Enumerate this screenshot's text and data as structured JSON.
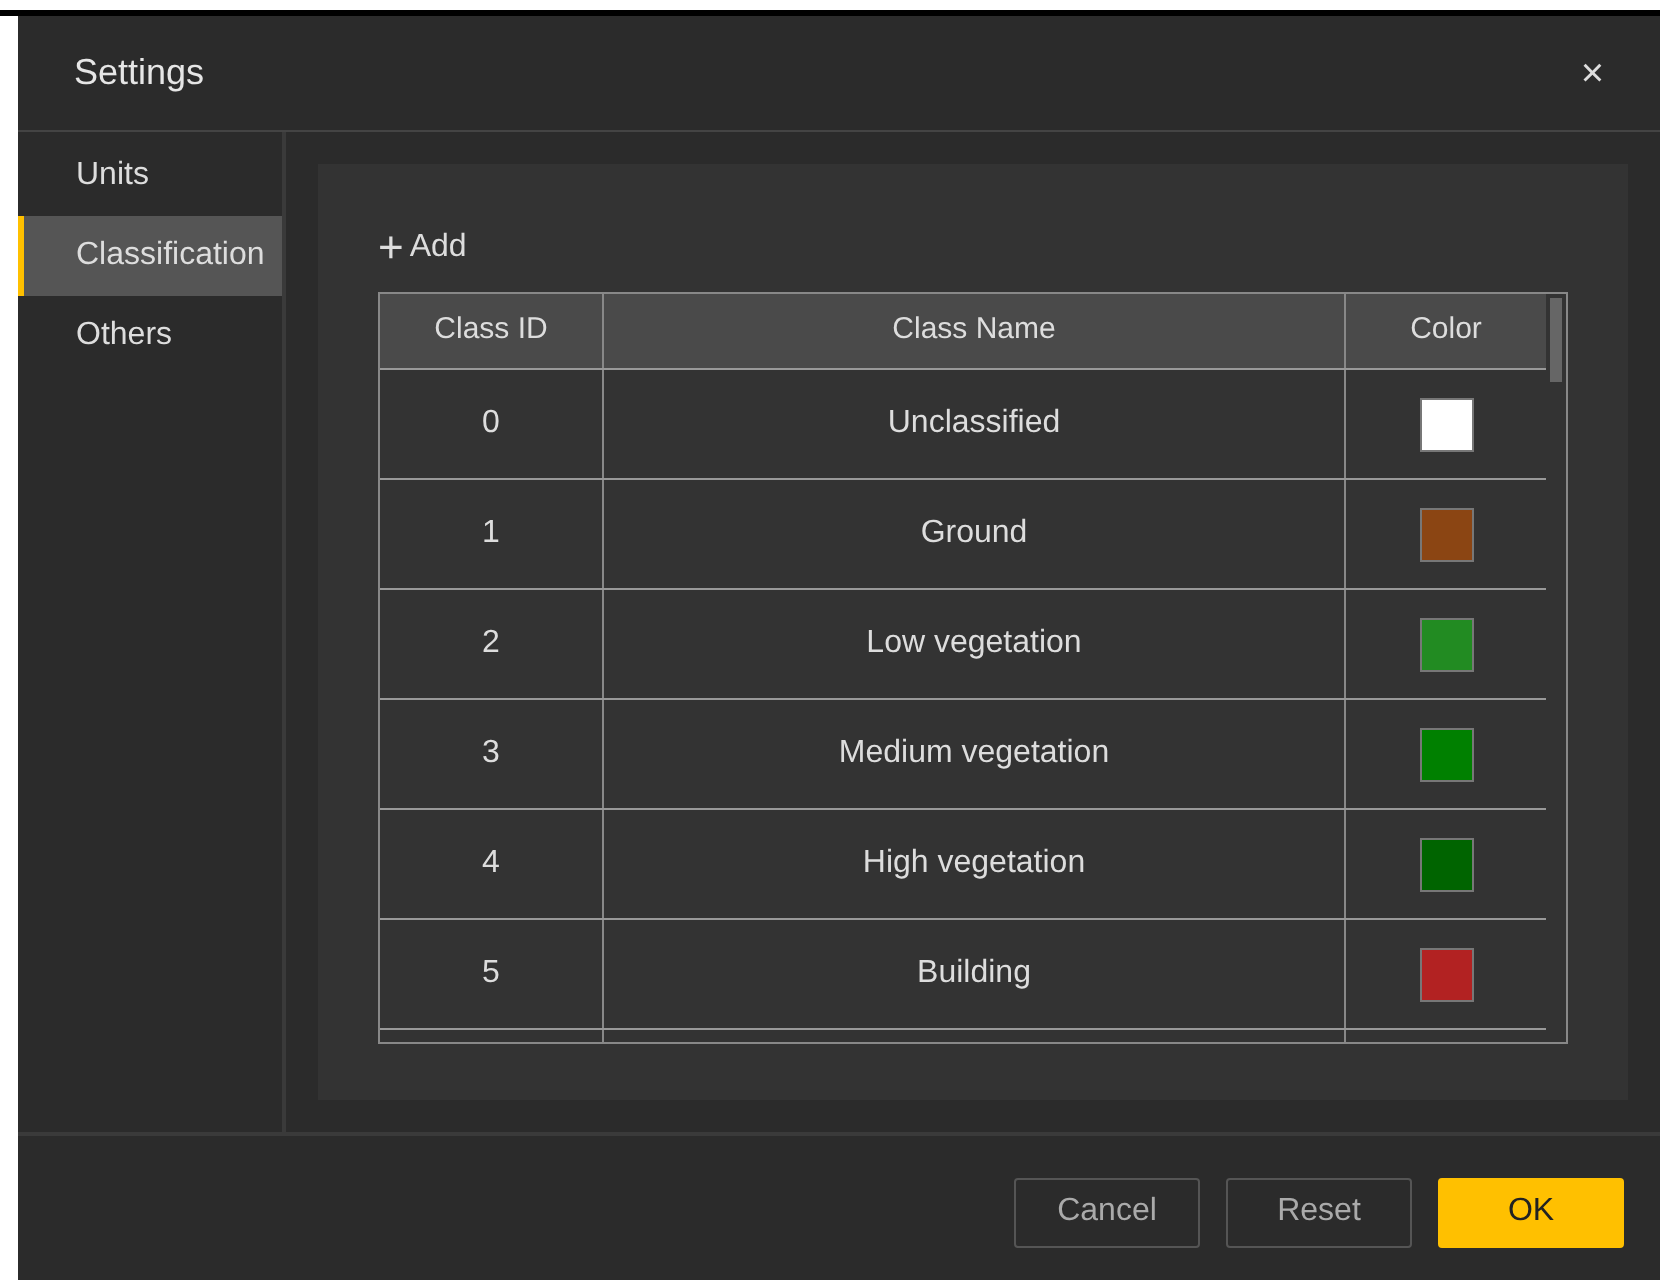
{
  "window": {
    "title": "Settings",
    "close": "×"
  },
  "sidebar": {
    "items": [
      {
        "label": "Units",
        "selected": false
      },
      {
        "label": "Classification",
        "selected": true
      },
      {
        "label": "Others",
        "selected": false
      }
    ]
  },
  "add_button": {
    "icon": "+",
    "label": "Add"
  },
  "table": {
    "columns": [
      "Class ID",
      "Class Name",
      "Color"
    ],
    "rows": [
      {
        "id": "0",
        "name": "Unclassified",
        "color": "#ffffff"
      },
      {
        "id": "1",
        "name": "Ground",
        "color": "#8b4513"
      },
      {
        "id": "2",
        "name": "Low vegetation",
        "color": "#228b22"
      },
      {
        "id": "3",
        "name": "Medium vegetation",
        "color": "#008000"
      },
      {
        "id": "4",
        "name": "High vegetation",
        "color": "#006400"
      },
      {
        "id": "5",
        "name": "Building",
        "color": "#b22222"
      }
    ]
  },
  "buttons": [
    {
      "label": "Cancel",
      "kind": "secondary"
    },
    {
      "label": "Reset",
      "kind": "secondary"
    },
    {
      "label": "OK",
      "kind": "primary"
    }
  ]
}
